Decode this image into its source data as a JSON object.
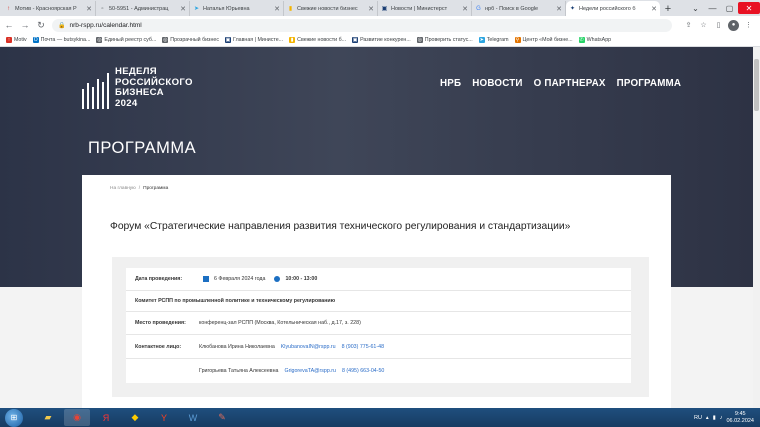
{
  "browser": {
    "tabs": [
      {
        "title": "Мотив - Красноярская Р",
        "icon": "arrow-up-icon",
        "color": "#d93025"
      },
      {
        "title": "50-5951 - Администрац",
        "icon": "blank-page-icon",
        "color": "#5f6368"
      },
      {
        "title": "Наталья Юрьевна",
        "icon": "telegram-icon",
        "color": "#2ca5e0"
      },
      {
        "title": "Свежие новости бизнес",
        "icon": "chart-icon",
        "color": "#f4b400"
      },
      {
        "title": "Новости | Министерст",
        "icon": "ministry-icon",
        "color": "#1a3e73"
      },
      {
        "title": "нрб - Поиск в Google",
        "icon": "google-icon",
        "color": "#4285f4"
      },
      {
        "title": "Недели российского б",
        "icon": "rspp-icon",
        "color": "#1a3e73",
        "active": true
      }
    ],
    "url": "nrb-rspp.ru/calendar.html",
    "bookmarks": [
      {
        "label": "Motiv",
        "icon": "arrow-up-icon",
        "color": "#d93025"
      },
      {
        "label": "Почта — butsykina...",
        "icon": "outlook-icon",
        "color": "#0072c6"
      },
      {
        "label": "Единый реестр суб...",
        "icon": "globe-icon",
        "color": "#5f6368"
      },
      {
        "label": "Прозрачный бизнес",
        "icon": "globe-icon",
        "color": "#5f6368"
      },
      {
        "label": "Главная | Министе...",
        "icon": "ministry-icon",
        "color": "#1a3e73"
      },
      {
        "label": "Свежие новости б...",
        "icon": "chart-icon",
        "color": "#f4b400"
      },
      {
        "label": "Развитие конкурен...",
        "icon": "ministry-icon",
        "color": "#1a3e73"
      },
      {
        "label": "Проверить статус...",
        "icon": "globe-icon",
        "color": "#5f6368"
      },
      {
        "label": "Telegram",
        "icon": "telegram-icon",
        "color": "#2ca5e0"
      },
      {
        "label": "Центр «Мой бизне...",
        "icon": "pin-icon",
        "color": "#e37400"
      },
      {
        "label": "WhatsApp",
        "icon": "whatsapp-icon",
        "color": "#25d366"
      }
    ]
  },
  "site": {
    "logo_lines": [
      "НЕДЕЛЯ",
      "РОССИЙСКОГО",
      "БИЗНЕСА",
      "2024"
    ],
    "nav": [
      "НРБ",
      "НОВОСТИ",
      "О ПАРТНЕРАХ",
      "ПРОГРАММА"
    ],
    "hero_title": "ПРОГРАММА",
    "breadcrumb": {
      "home": "На главную",
      "sep": "/",
      "current": "Программа"
    },
    "forum_title": "Форум «Стратегические направления развития технического регулирования и стандартизации»",
    "event": {
      "date_label": "Дата проведения:",
      "date": "6 Февраля 2024 года",
      "time": "10:00 - 13:00",
      "committee": "Комитет РСПП по промышленной политике и техническому регулированию",
      "place_label": "Место проведения:",
      "place": "конференц-зал РСПП (Москва, Котельническая наб., д.17, з. 228)",
      "contact_label": "Контактное лицо:",
      "contacts": [
        {
          "name": "Клюбанова Ирина Николаевна",
          "email": "KlyubanovaIN@rspp.ru",
          "phone": "8 (903) 775-61-48"
        },
        {
          "name": "Григорьева Татьяна Алексеевна",
          "email": "GrigorevaTA@rspp.ru",
          "phone": "8 (495) 663-04-50"
        }
      ]
    }
  },
  "taskbar": {
    "lang": "RU",
    "time": "9:45",
    "date": "06.02.2024"
  }
}
